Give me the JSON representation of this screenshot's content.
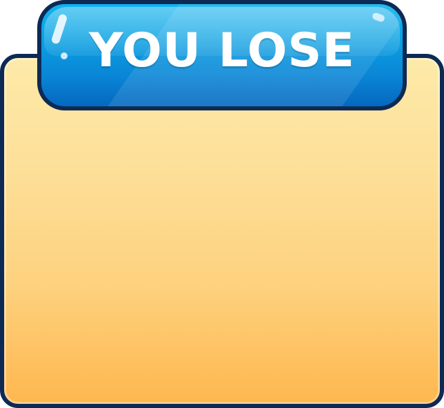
{
  "banner": {
    "title": "YOU LOSE"
  },
  "colors": {
    "outline": "#0d2a55",
    "banner_top": "#10b3ee",
    "banner_bottom": "#0568bf",
    "panel_top": "#fdeaa9",
    "panel_bottom": "#feb74f",
    "title_text": "#ffffff"
  }
}
